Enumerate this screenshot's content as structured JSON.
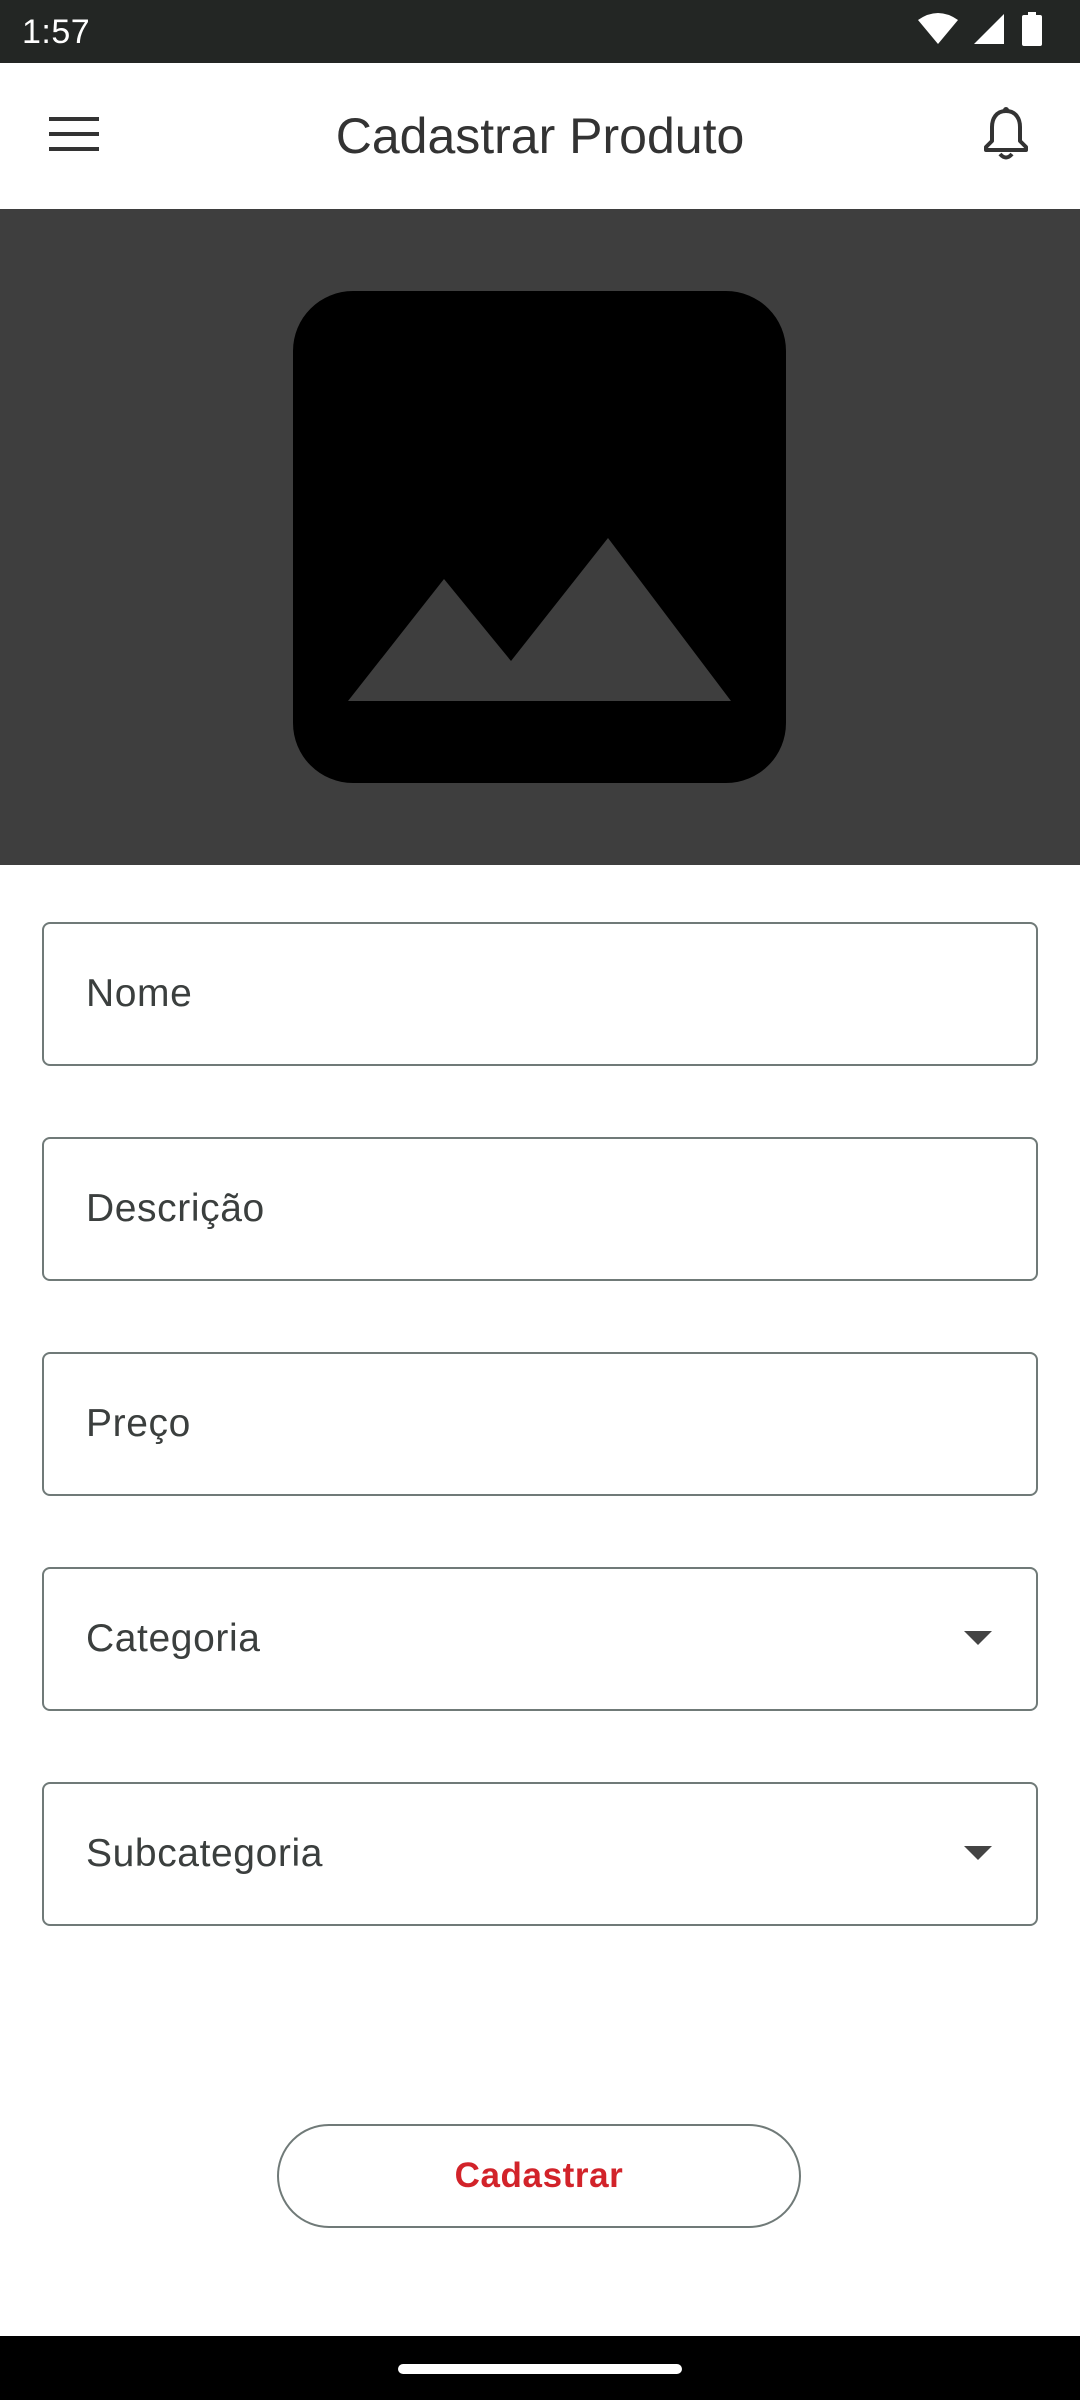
{
  "status_bar": {
    "time": "1:57",
    "icons": [
      "wifi-icon",
      "cellular-signal-icon",
      "battery-icon"
    ]
  },
  "app_bar": {
    "title": "Cadastrar Produto",
    "left_icon": "menu-icon",
    "right_icon": "bell-icon"
  },
  "image_picker": {
    "icon": "image-placeholder-icon",
    "background": "#3e3e3e"
  },
  "form": {
    "fields": [
      {
        "label": "Nome",
        "type": "text"
      },
      {
        "label": "Descrição",
        "type": "text"
      },
      {
        "label": "Preço",
        "type": "text"
      },
      {
        "label": "Categoria",
        "type": "dropdown"
      },
      {
        "label": "Subcategoria",
        "type": "dropdown"
      }
    ],
    "submit_label": "Cadastrar"
  },
  "colors": {
    "accent": "#d2232a",
    "status_bar": "#232624",
    "border": "#707a78"
  }
}
